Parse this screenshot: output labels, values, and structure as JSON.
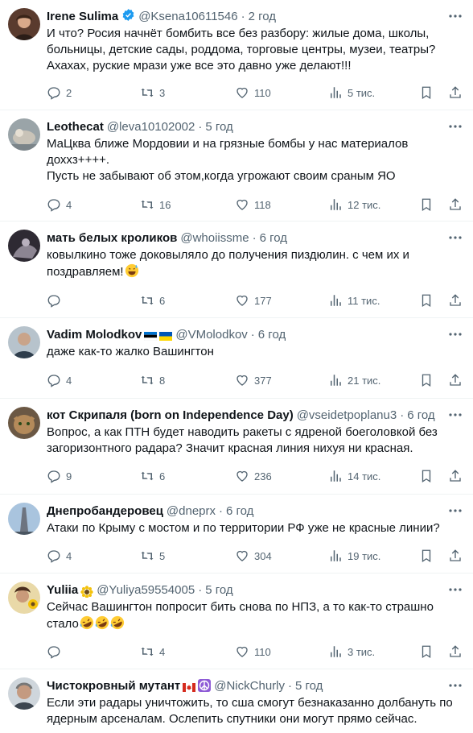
{
  "tweets": [
    {
      "name": "Irene Sulima",
      "verified": true,
      "handle": "@Ksena10611546",
      "time": "2 год",
      "text": "И что? Росия начнёт бомбить все без разбору: жилые дома, школы, больницы, детские сады, роддома, торговые центры, музеи, театры?\nАхахах, руские мрази уже все это давно уже делают!!!",
      "replies": "2",
      "retweets": "3",
      "likes": "110",
      "views": "5 тис."
    },
    {
      "name": "Leothecat",
      "verified": false,
      "handle": "@leva10102002",
      "time": "5 год",
      "text": "МаЦква ближе Мордовии и на грязные бомбы у нас материалов дохxз++++.\nПусть не забывают об этом,когда угрожают своим сраным ЯО",
      "replies": "4",
      "retweets": "16",
      "likes": "118",
      "views": "12 тис."
    },
    {
      "name": "мать белых кроликов",
      "verified": false,
      "handle": "@whoiissme",
      "time": "6 год",
      "text": "ковылкино тоже доковыляло до получения пиздюлин. с чем их и поздравляем!",
      "emoji": "grin-sweat",
      "replies": "",
      "retweets": "6",
      "likes": "177",
      "views": "11 тис."
    },
    {
      "name": "Vadim Molodkov",
      "verified": false,
      "flags": [
        "estonia-flag",
        "ukraine-flag"
      ],
      "handle": "@VMolodkov",
      "time": "6 год",
      "text": "даже как-то жалко Вашингтон",
      "replies": "4",
      "retweets": "8",
      "likes": "377",
      "views": "21 тис."
    },
    {
      "name": "кот Скрипаля (born on Independence Day)",
      "verified": false,
      "handle": "@vseidetpoplanu3",
      "time": "6 год",
      "text": "Вопрос, а как ПТН будет наводить ракеты с ядреной боеголовкой без загоризонтного радара? Значит красная линия нихуя ни красная.",
      "replies": "9",
      "retweets": "6",
      "likes": "236",
      "views": "14 тис."
    },
    {
      "name": "Днепробандеровец",
      "verified": false,
      "handle": "@dneprx",
      "time": "6 год",
      "text": "Атаки по Крыму с мостом и по территории РФ уже не красные линии?",
      "replies": "4",
      "retweets": "5",
      "likes": "304",
      "views": "19 тис."
    },
    {
      "name": "Yuliia",
      "verified": false,
      "flags": [
        "sunflower-icon"
      ],
      "handle": "@Yuliya59554005",
      "time": "5 год",
      "text": "Сейчас Вашингтон попросит бить снова по НПЗ, а то как-то страшно стало",
      "emoji": "rofl-x3",
      "replies": "",
      "retweets": "4",
      "likes": "110",
      "views": "3 тис."
    },
    {
      "name": "Чистокровный мутант",
      "verified": false,
      "flags": [
        "canada-flag",
        "peace-icon"
      ],
      "handle": "@NickChurly",
      "time": "5 год",
      "text": "Если эти радары уничтожить, то сша смогут безнаказанно долбануть по ядерным арсеналам. Ослепить спутники они могут прямо сейчас.",
      "replies": "",
      "retweets": "",
      "likes": "",
      "views": ""
    }
  ],
  "colors": {
    "text": "#0f1419",
    "secondary": "#536471",
    "verified": "#1d9bf0",
    "divider": "#eff3f4"
  },
  "icons": [
    "reply-icon",
    "retweet-icon",
    "like-icon",
    "views-icon",
    "bookmark-icon",
    "share-icon",
    "more-icon"
  ]
}
